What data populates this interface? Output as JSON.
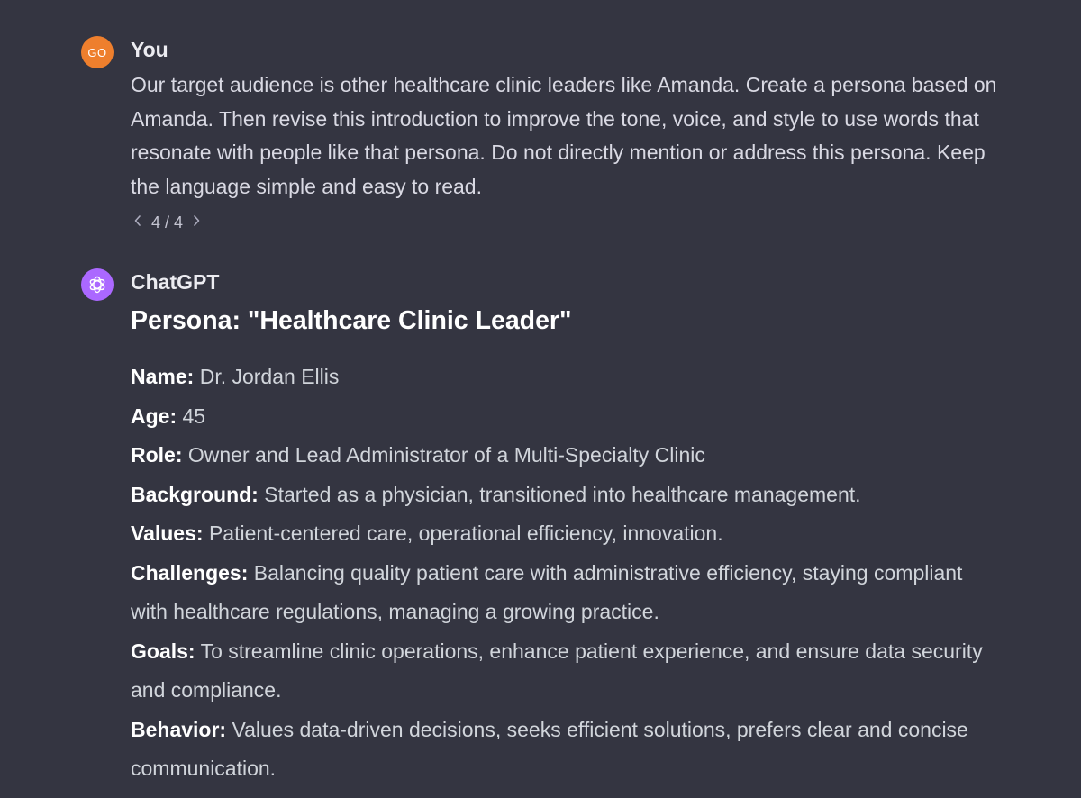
{
  "user_message": {
    "avatar_initials": "GO",
    "author": "You",
    "text": "Our target audience is other healthcare clinic leaders like Amanda. Create a persona based on Amanda. Then revise this introduction to improve the tone, voice, and style to use words that resonate with people like that persona.  Do not directly mention or address this persona. Keep the language simple and easy to read.",
    "pager": {
      "prev_icon": "chevron-left-icon",
      "label": "4 / 4",
      "next_icon": "chevron-right-icon"
    }
  },
  "assistant_message": {
    "author": "ChatGPT",
    "avatar_icon": "openai-logo-icon",
    "persona_title": "Persona: \"Healthcare Clinic Leader\"",
    "fields": [
      {
        "label": "Name:",
        "value": "Dr. Jordan Ellis"
      },
      {
        "label": "Age:",
        "value": "45"
      },
      {
        "label": "Role:",
        "value": "Owner and Lead Administrator of a Multi-Specialty Clinic"
      },
      {
        "label": "Background:",
        "value": "Started as a physician, transitioned into healthcare management."
      },
      {
        "label": "Values:",
        "value": "Patient-centered care, operational efficiency, innovation."
      },
      {
        "label": "Challenges:",
        "value": "Balancing quality patient care with administrative efficiency, staying compliant with healthcare regulations, managing a growing practice."
      },
      {
        "label": "Goals:",
        "value": "To streamline clinic operations, enhance patient experience, and ensure data security and compliance."
      },
      {
        "label": "Behavior:",
        "value": "Values data-driven decisions, seeks efficient solutions, prefers clear and concise communication."
      }
    ]
  },
  "colors": {
    "background": "#343541",
    "user_avatar": "#ee7f2d",
    "assistant_avatar": "#ab68ff"
  }
}
